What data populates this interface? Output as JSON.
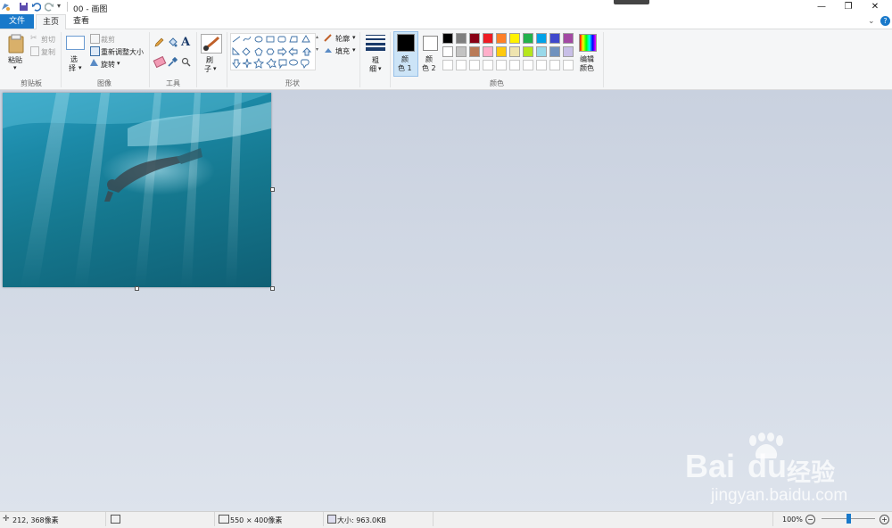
{
  "window": {
    "title": "00 - 画图",
    "minimize_glyph": "—",
    "maximize_glyph": "❐",
    "close_glyph": "✕"
  },
  "tabs": [
    {
      "label": "文件",
      "active": false
    },
    {
      "label": "主页",
      "active": true
    },
    {
      "label": "查看",
      "active": false
    }
  ],
  "ribbon": {
    "clipboard": {
      "paste": "粘贴",
      "cut": "剪切",
      "copy": "复制",
      "group": "剪贴板"
    },
    "image": {
      "select_line1": "选",
      "select_line2": "择",
      "crop": "裁剪",
      "resize": "重新调整大小",
      "rotate": "旋转",
      "group": "图像"
    },
    "tools": {
      "group": "工具",
      "text_glyph": "A"
    },
    "brushes": {
      "line1": "刷",
      "line2": "子"
    },
    "shapes": {
      "outline": "轮廓",
      "fill": "填充",
      "group": "形状"
    },
    "size": {
      "line1": "粗",
      "line2": "细"
    },
    "color1": {
      "line1": "颜",
      "line2": "色 1"
    },
    "color2": {
      "line1": "颜",
      "line2": "色 2"
    },
    "colors": {
      "group": "颜色",
      "edit_line1": "编辑",
      "edit_line2": "颜色",
      "row1": [
        "#000000",
        "#7f7f7f",
        "#880015",
        "#ed1c24",
        "#ff7f27",
        "#fff200",
        "#22b14c",
        "#00a2e8",
        "#3f48cc",
        "#a349a4"
      ],
      "row2": [
        "#ffffff",
        "#c3c3c3",
        "#b97a57",
        "#ffaec9",
        "#ffc90e",
        "#efe4b0",
        "#b5e61d",
        "#99d9ea",
        "#7092be",
        "#c8bfe7"
      ],
      "row3": [
        "#ffffff",
        "#ffffff",
        "#ffffff",
        "#ffffff",
        "#ffffff",
        "#ffffff",
        "#ffffff",
        "#ffffff",
        "#ffffff",
        "#ffffff"
      ]
    }
  },
  "status": {
    "cursor_pos": "212, 368像素",
    "image_size": "550 × 400像素",
    "file_size": "大小: 963.0KB",
    "zoom": "100%",
    "zoom_fraction": 0.5
  },
  "watermark": {
    "brand": "Bai",
    "brand2": "du",
    "cn": "经验",
    "url": "jingyan.baidu.com"
  }
}
